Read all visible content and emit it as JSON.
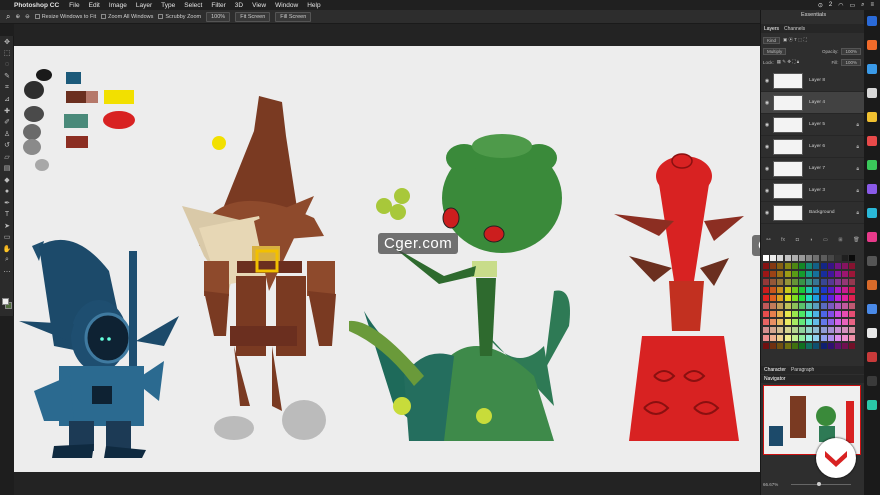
{
  "menubar": {
    "app_name": "Photoshop CC",
    "items": [
      "File",
      "Edit",
      "Image",
      "Layer",
      "Type",
      "Select",
      "Filter",
      "3D",
      "View",
      "Window",
      "Help"
    ],
    "status_number": "2"
  },
  "options_bar": {
    "resize_label": "Resize Windows to Fit",
    "zoom_all_label": "Zoom All Windows",
    "scrubby_label": "Scrubby Zoom",
    "zoom_value": "100%",
    "fit_screen": "Fit Screen",
    "fill_screen": "Fill Screen"
  },
  "workspace": {
    "label": "Essentials"
  },
  "layers_panel": {
    "tabs": [
      "Layers",
      "Channels"
    ],
    "filter_kind": "Kind",
    "blend_mode": "Multiply",
    "opacity_label": "Opacity:",
    "opacity_value": "100%",
    "lock_label": "Lock:",
    "fill_label": "Fill:",
    "fill_value": "100%",
    "layers": [
      {
        "name": "Layer 8",
        "visible": true,
        "selected": false,
        "locked": false
      },
      {
        "name": "Layer 4",
        "visible": true,
        "selected": true,
        "locked": false
      },
      {
        "name": "Layer 5",
        "visible": true,
        "selected": false,
        "locked": true
      },
      {
        "name": "Layer 6",
        "visible": true,
        "selected": false,
        "locked": true
      },
      {
        "name": "Layer 7",
        "visible": true,
        "selected": false,
        "locked": true
      },
      {
        "name": "Layer 3",
        "visible": true,
        "selected": false,
        "locked": true
      },
      {
        "name": "Background",
        "visible": true,
        "selected": false,
        "locked": true
      }
    ]
  },
  "lower_panel": {
    "tabs": [
      "Character",
      "Paragraph"
    ],
    "navigator_label": "Navigator",
    "zoom_level": "66.67%"
  },
  "watermark": {
    "text": "Cger.com"
  },
  "colors": {
    "palette": [
      "#1a1a1a",
      "#2e2e2e",
      "#4a4a4a",
      "#6a6a6a",
      "#8a8a8a",
      "#a8a8a8",
      "#1c5a7a",
      "#6b2f1f",
      "#b5786a",
      "#4a8a7a",
      "#8c2e22",
      "#f2e000",
      "#d82222"
    ]
  }
}
